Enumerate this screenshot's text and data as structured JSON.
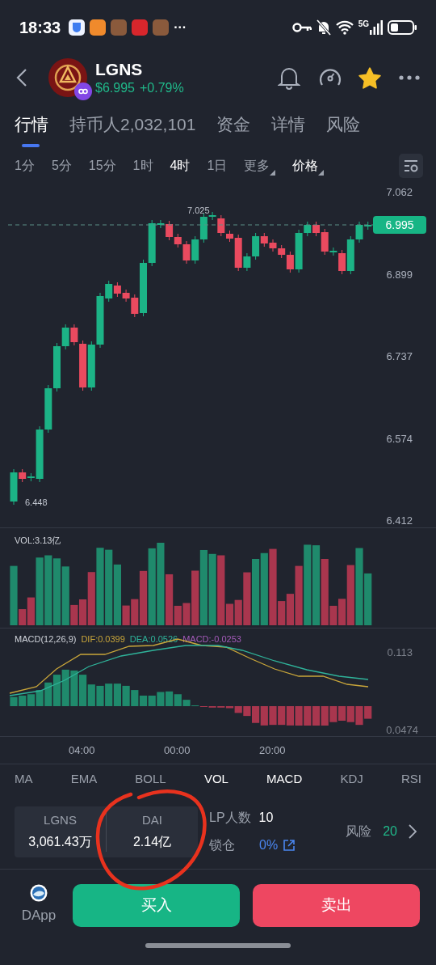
{
  "status_bar": {
    "time": "18:33",
    "more": "···",
    "network": "5G"
  },
  "token": {
    "symbol": "LGNS",
    "price": "$6.995",
    "change": "+0.79%",
    "starred": true
  },
  "tabs": [
    {
      "label": "行情",
      "selected": true
    },
    {
      "label": "持币人2,032,101",
      "selected": false
    },
    {
      "label": "资金",
      "selected": false
    },
    {
      "label": "详情",
      "selected": false
    },
    {
      "label": "风险",
      "selected": false
    }
  ],
  "intervals": [
    {
      "label": "1分",
      "selected": false,
      "kind": "plain"
    },
    {
      "label": "5分",
      "selected": false,
      "kind": "plain"
    },
    {
      "label": "15分",
      "selected": false,
      "kind": "plain"
    },
    {
      "label": "1时",
      "selected": false,
      "kind": "plain"
    },
    {
      "label": "4时",
      "selected": true,
      "kind": "plain"
    },
    {
      "label": "1日",
      "selected": false,
      "kind": "plain"
    },
    {
      "label": "更多",
      "selected": false,
      "kind": "dropdown"
    },
    {
      "label": "价格",
      "selected": true,
      "kind": "dropdown"
    }
  ],
  "price_chart": {
    "axis": [
      "7.062",
      "6.899",
      "6.737",
      "6.574",
      "6.412"
    ],
    "current_price": "6.995",
    "high": "7.025",
    "low": "6.448"
  },
  "volume": {
    "label": "VOL:3.13亿"
  },
  "macd": {
    "label": "MACD(12,26,9)",
    "dif": "DIF:0.0399",
    "dea": "DEA:0.0526",
    "macd": "MACD:-0.0253",
    "axis": [
      "0.113",
      "0.0474"
    ]
  },
  "time_axis": [
    "04:00",
    "00:00",
    "20:00"
  ],
  "indicators": [
    {
      "label": "MA",
      "selected": false
    },
    {
      "label": "EMA",
      "selected": false
    },
    {
      "label": "BOLL",
      "selected": false
    },
    {
      "label": "VOL",
      "selected": true
    },
    {
      "label": "MACD",
      "selected": true
    },
    {
      "label": "KDJ",
      "selected": false
    },
    {
      "label": "RSI",
      "selected": false
    }
  ],
  "liquidity": [
    {
      "symbol": "LGNS",
      "amount": "3,061.43万"
    },
    {
      "symbol": "DAI",
      "amount": "2.14亿"
    }
  ],
  "lp": {
    "label": "LP人数",
    "value": "10"
  },
  "lock": {
    "label": "锁仓",
    "value": "0%"
  },
  "risk": {
    "label": "风险",
    "value": "20"
  },
  "actions": {
    "dapp": "DApp",
    "buy": "买入",
    "sell": "卖出"
  }
}
